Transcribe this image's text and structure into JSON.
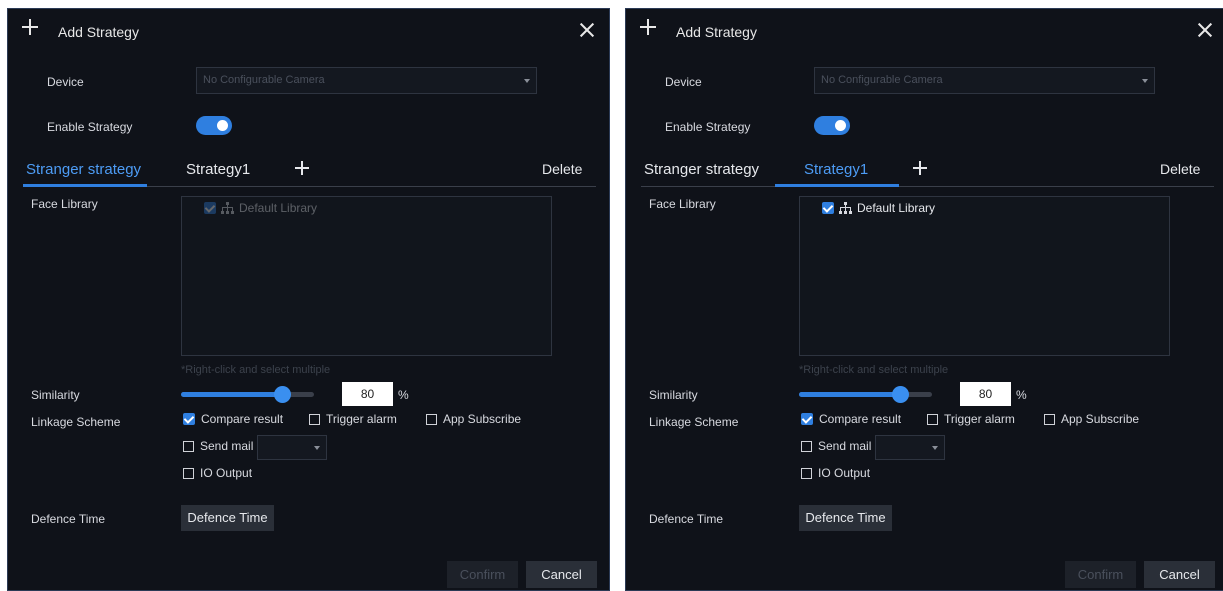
{
  "dialogs": [
    {
      "title": "Add Strategy",
      "device_label": "Device",
      "device_placeholder": "No Configurable Camera",
      "enable_label": "Enable Strategy",
      "tabs": [
        "Stranger strategy",
        "Strategy1"
      ],
      "active_tab": "Stranger strategy",
      "delete_label": "Delete",
      "face_library_label": "Face Library",
      "library_item": "Default Library",
      "library_item_enabled": false,
      "hint": "*Right-click and select multiple",
      "similarity_label": "Similarity",
      "similarity_value": "80",
      "percent": "%",
      "linkage_label": "Linkage Scheme",
      "compare_result": "Compare result",
      "trigger_alarm": "Trigger alarm",
      "app_subscribe": "App Subscribe",
      "send_mail": "Send mail",
      "io_output": "IO Output",
      "defence_label": "Defence Time",
      "defence_button": "Defence Time",
      "confirm": "Confirm",
      "cancel": "Cancel"
    },
    {
      "title": "Add Strategy",
      "device_label": "Device",
      "device_placeholder": "No Configurable Camera",
      "enable_label": "Enable Strategy",
      "tabs": [
        "Stranger strategy",
        "Strategy1"
      ],
      "active_tab": "Strategy1",
      "delete_label": "Delete",
      "face_library_label": "Face Library",
      "library_item": "Default Library",
      "library_item_enabled": true,
      "hint": "*Right-click and select multiple",
      "similarity_label": "Similarity",
      "similarity_value": "80",
      "percent": "%",
      "linkage_label": "Linkage Scheme",
      "compare_result": "Compare result",
      "trigger_alarm": "Trigger alarm",
      "app_subscribe": "App Subscribe",
      "send_mail": "Send mail",
      "io_output": "IO Output",
      "defence_label": "Defence Time",
      "defence_button": "Defence Time",
      "confirm": "Confirm",
      "cancel": "Cancel"
    }
  ],
  "similarity_level_percent": 80,
  "colors": {
    "background": "#0f1219",
    "accent": "#2f7fe0",
    "active_tab": "#4d9cf5"
  }
}
